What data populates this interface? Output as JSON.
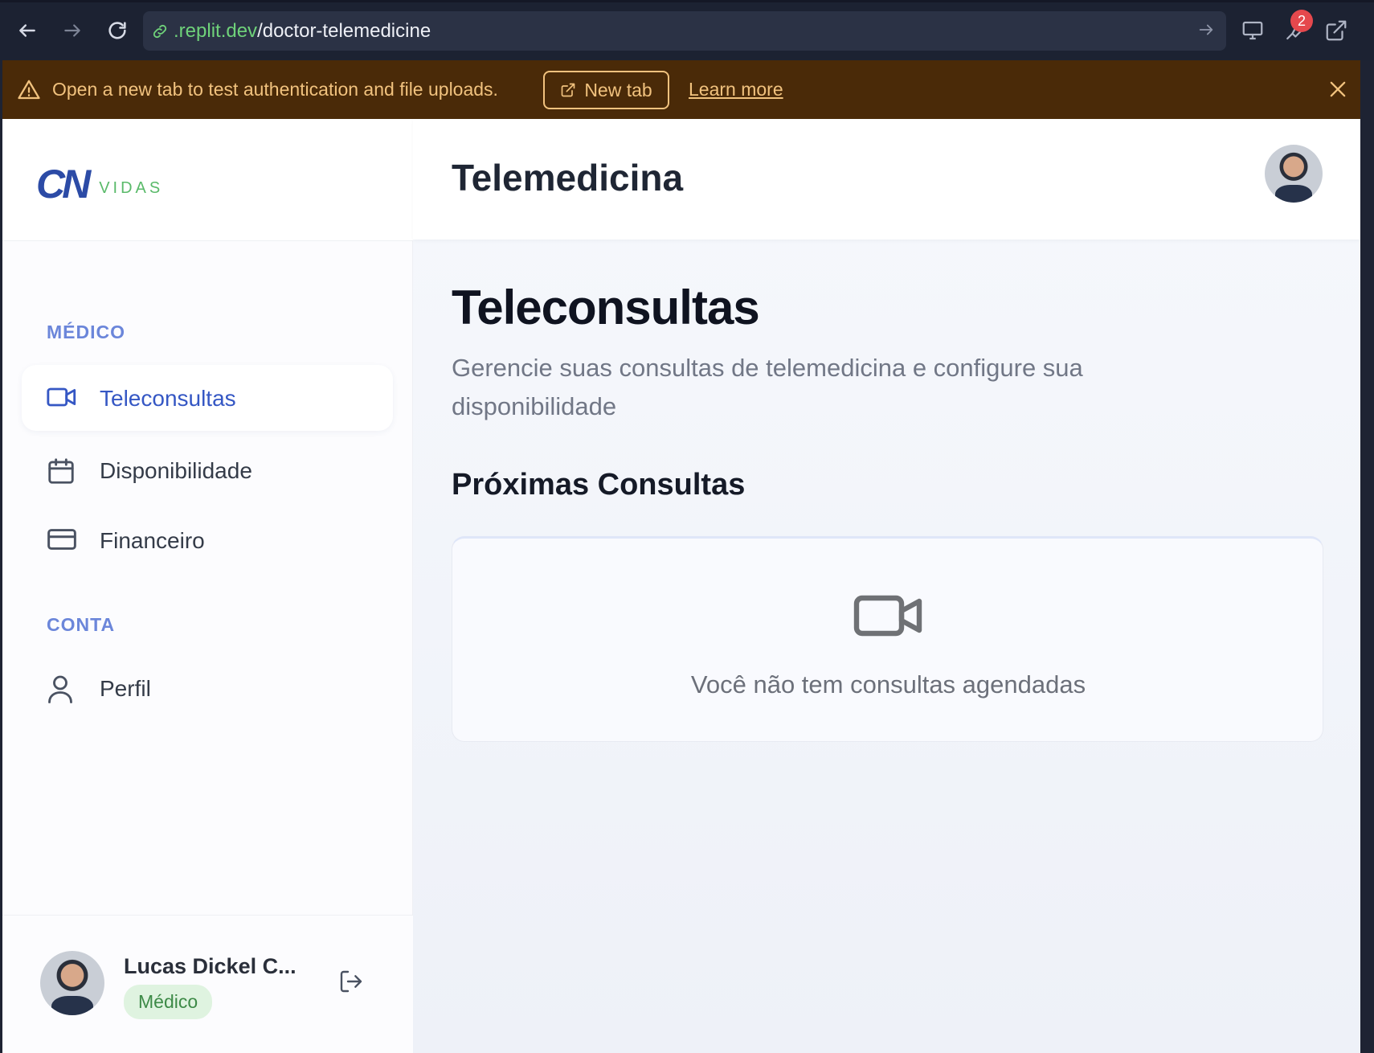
{
  "browser": {
    "url_domain": ".replit.dev",
    "url_path": "/doctor-telemedicine",
    "notification_count": "2"
  },
  "banner": {
    "message": "Open a new tab to test authentication and file uploads.",
    "new_tab_label": "New tab",
    "learn_more_label": "Learn more"
  },
  "sidebar": {
    "logo_mark": "CN",
    "logo_word": "VIDAS",
    "section_medico": "MÉDICO",
    "items": [
      {
        "label": "Teleconsultas",
        "icon": "video-icon",
        "active": true
      },
      {
        "label": "Disponibilidade",
        "icon": "calendar-icon",
        "active": false
      },
      {
        "label": "Financeiro",
        "icon": "credit-card-icon",
        "active": false
      }
    ],
    "section_conta": "CONTA",
    "account_items": [
      {
        "label": "Perfil",
        "icon": "user-icon"
      }
    ],
    "user": {
      "name": "Lucas Dickel C...",
      "role": "Médico"
    }
  },
  "header": {
    "title": "Telemedicina"
  },
  "main": {
    "heading": "Teleconsultas",
    "subtitle": "Gerencie suas consultas de telemedicina e configure sua disponibilidade",
    "section_title": "Próximas Consultas",
    "empty_state": "Você não tem consultas agendadas"
  },
  "colors": {
    "accent": "#3557c4",
    "banner_bg": "#4a2a08",
    "banner_text": "#f1c27e",
    "role_badge_bg": "#dff3e0"
  }
}
